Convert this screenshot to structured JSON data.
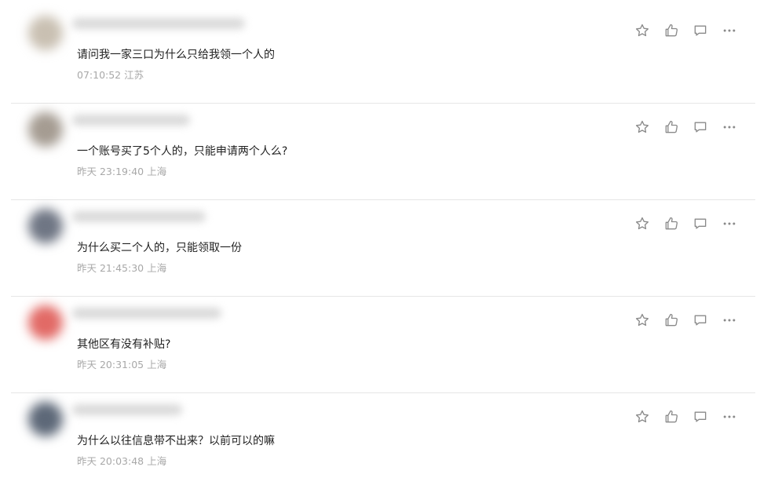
{
  "comments": [
    {
      "text": "请问我一家三口为什么只给我领一个人的",
      "time": "07:10:52",
      "location": "江苏",
      "avatar_color": "#c9c0b2"
    },
    {
      "text": "一个账号买了5个人的，只能申请两个人么?",
      "time": "昨天 23:19:40",
      "location": "上海",
      "avatar_color": "#a59c92"
    },
    {
      "text": "为什么买二个人的，只能领取一份",
      "time": "昨天 21:45:30",
      "location": "上海",
      "avatar_color": "#6f7684"
    },
    {
      "text": "其他区有没有补贴?",
      "time": "昨天 20:31:05",
      "location": "上海",
      "avatar_color": "#e26a66"
    },
    {
      "text": "为什么以往信息带不出来？以前可以的嘛",
      "time": "昨天 20:03:48",
      "location": "上海",
      "avatar_color": "#5d6878"
    }
  ],
  "action_icons": [
    "star-icon",
    "thumbs-up-icon",
    "comment-icon",
    "more-icon"
  ],
  "colors": {
    "text": "#222222",
    "meta": "#a8a8a8",
    "icon": "#8a8a8a",
    "divider": "#e6e6e6"
  }
}
